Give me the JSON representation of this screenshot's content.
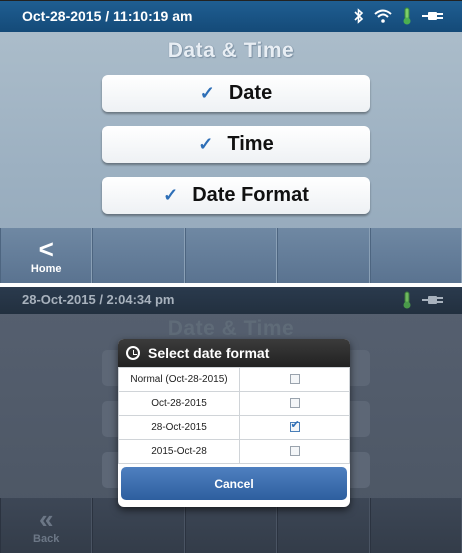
{
  "screen1": {
    "status_datetime": "Oct-28-2015 / 11:10:19 am",
    "status_icons": [
      "bluetooth-icon",
      "wifi-icon",
      "thermometer-icon",
      "plug-icon"
    ],
    "title": "Data & Time",
    "menu": [
      {
        "label": "Date",
        "checked": true
      },
      {
        "label": "Time",
        "checked": true
      },
      {
        "label": "Date Format",
        "checked": true
      }
    ],
    "nav_home_label": "Home"
  },
  "screen2": {
    "status_datetime": "28-Oct-2015 / 2:04:34 pm",
    "status_icons": [
      "thermometer-icon",
      "plug-icon"
    ],
    "title": "Date & Time",
    "dialog": {
      "title": "Select date format",
      "options": [
        {
          "label": "Normal (Oct-28-2015)",
          "selected": false
        },
        {
          "label": "Oct-28-2015",
          "selected": false
        },
        {
          "label": "28-Oct-2015",
          "selected": true
        },
        {
          "label": "2015-Oct-28",
          "selected": false
        }
      ],
      "cancel_label": "Cancel"
    },
    "nav_back_label": "Back"
  },
  "colors": {
    "statusbar_blue": "#1a5585",
    "check_blue": "#2e6fb7",
    "thermometer_green": "#4caf50",
    "cancel_blue": "#3e70b0"
  },
  "glyphs": {
    "check": "✓",
    "chevron_left": "<",
    "double_chevron_left": "«"
  }
}
